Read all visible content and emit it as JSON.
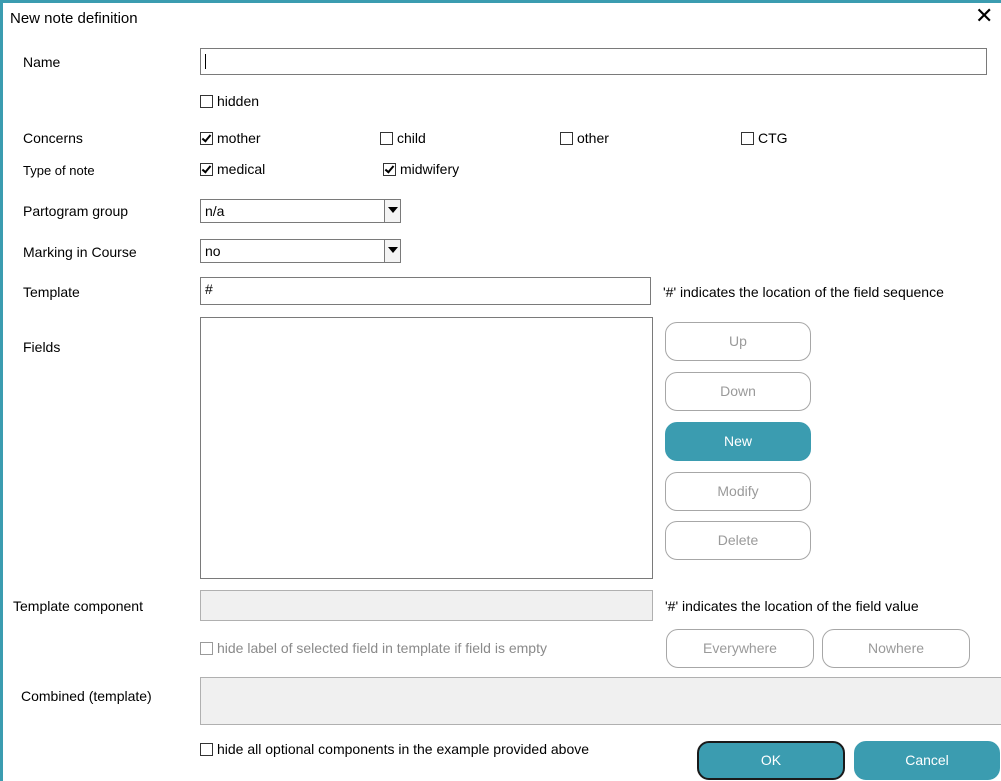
{
  "window": {
    "title": "New note definition",
    "close_glyph": "✕"
  },
  "labels": {
    "name": "Name",
    "concerns": "Concerns",
    "type_of_note": "Type of note",
    "partogram_group": "Partogram group",
    "marking_in_course": "Marking in Course",
    "template": "Template",
    "fields": "Fields",
    "template_component": "Template  component",
    "combined": "Combined (template)"
  },
  "name_field": {
    "value": ""
  },
  "hidden_checkbox": {
    "label": "hidden",
    "checked": false
  },
  "concerns": [
    {
      "label": "mother",
      "checked": true
    },
    {
      "label": "child",
      "checked": false
    },
    {
      "label": "other",
      "checked": false
    },
    {
      "label": "CTG",
      "checked": false
    }
  ],
  "type_of_note": [
    {
      "label": "medical",
      "checked": true
    },
    {
      "label": "midwifery",
      "checked": true
    }
  ],
  "partogram_group": {
    "selected": "n/a"
  },
  "marking_in_course": {
    "selected": "no"
  },
  "template_field": {
    "value": "#",
    "hint": "'#' indicates the location of the field sequence"
  },
  "field_buttons": {
    "up": "Up",
    "down": "Down",
    "new": "New",
    "modify": "Modify",
    "delete": "Delete"
  },
  "template_component": {
    "value": "",
    "hint": "'#' indicates the location of the field value"
  },
  "hide_label_checkbox": {
    "label": "hide label of selected field in template if field is empty",
    "checked": false
  },
  "scope_buttons": {
    "everywhere": "Everywhere",
    "nowhere": "Nowhere"
  },
  "combined_field": {
    "value": ""
  },
  "hide_optional_checkbox": {
    "label": "hide all optional components in the example provided above",
    "checked": false
  },
  "footer": {
    "ok": "OK",
    "cancel": "Cancel"
  },
  "colors": {
    "accent": "#3b9cb0",
    "disabled_text": "#9a9a9a",
    "disabled_bg": "#f0f0f0"
  }
}
